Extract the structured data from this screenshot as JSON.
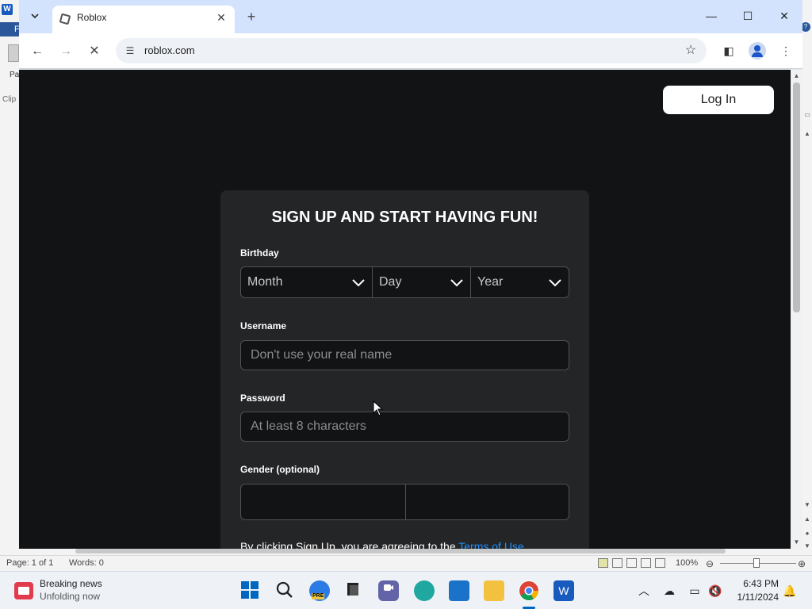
{
  "word": {
    "logo_letter": "W",
    "file_tab_label": "F",
    "paste_label": "Pa",
    "clipboard_label": "Clip",
    "status": {
      "page": "Page: 1 of 1",
      "words": "Words: 0",
      "zoom": "100%"
    }
  },
  "browser": {
    "tab": {
      "title": "Roblox"
    },
    "address": {
      "url": "roblox.com"
    },
    "colors": {
      "tabbar": "#d3e3fd",
      "toolbar": "#ffffff"
    }
  },
  "page": {
    "colors": {
      "background": "#121315",
      "card": "#232527",
      "link": "#1e90ff"
    },
    "login_label": "Log In",
    "signup": {
      "title": "SIGN UP AND START HAVING FUN!",
      "birthday_label": "Birthday",
      "month": "Month",
      "day": "Day",
      "year": "Year",
      "username_label": "Username",
      "username_placeholder": "Don't use your real name",
      "password_label": "Password",
      "password_placeholder": "At least 8 characters",
      "gender_label": "Gender (optional)",
      "terms_text": "By clicking Sign Up, you are agreeing to the ",
      "terms_link": "Terms of Use"
    }
  },
  "taskbar": {
    "news_title": "Breaking news",
    "news_subtitle": "Unfolding now",
    "clock_time": "6:43 PM",
    "clock_date": "1/11/2024",
    "edge_badge": "PRE"
  }
}
